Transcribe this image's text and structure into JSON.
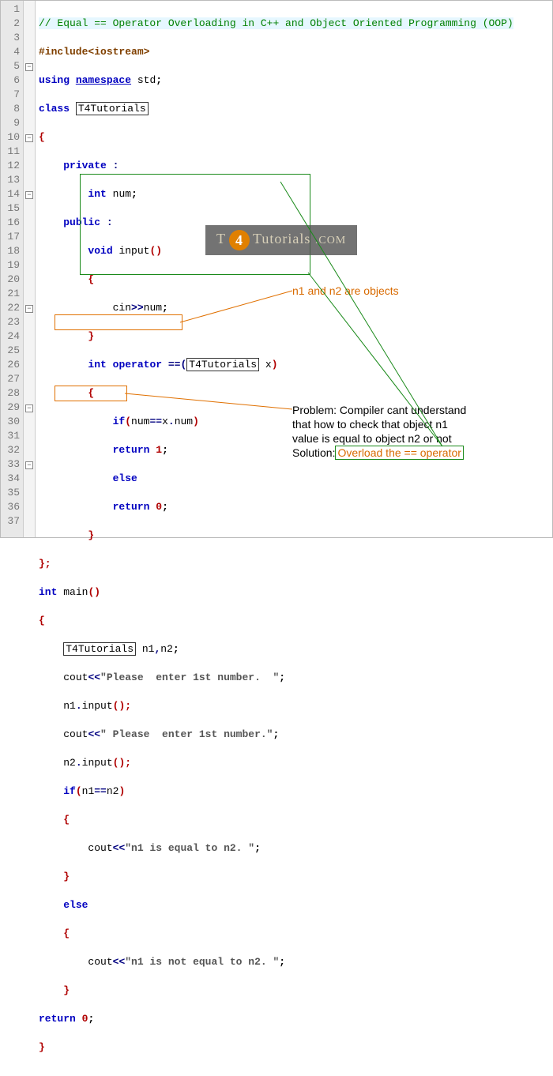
{
  "lines": {
    "count": 37,
    "folds": {
      "5": "⊟",
      "10": "⊟",
      "14": "⊟",
      "22": "⊟",
      "29": "⊟",
      "33": "⊟"
    }
  },
  "code": {
    "l1": "// Equal == Operator Overloading in C++ and Object Oriented Programming (OOP)",
    "l2a": "#include",
    "l2b": "<iostream>",
    "l3a": "using",
    "l3b": "namespace",
    "l3c": "std",
    "l3d": ";",
    "l4a": "class",
    "l4b": "T4Tutorials",
    "l5": "{",
    "l6a": "private",
    "l6b": ":",
    "l7a": "int",
    "l7b": "num",
    "l7c": ";",
    "l8a": "public",
    "l8b": ":",
    "l9a": "void",
    "l9b": "input",
    "l9c": "()",
    "l10": "{",
    "l11a": "cin",
    "l11b": ">>",
    "l11c": "num",
    "l11d": ";",
    "l12": "}",
    "l13a": "int",
    "l13b": "operator",
    "l13c": "==(",
    "l13d": "T4Tutorials",
    "l13e": "x",
    "l13f": ")",
    "l14": "{",
    "l15a": "if",
    "l15b": "(",
    "l15c": "num",
    "l15d": "==",
    "l15e": "x",
    "l15f": ".",
    "l15g": "num",
    "l15h": ")",
    "l16a": "return",
    "l16b": "1",
    "l16c": ";",
    "l17a": "else",
    "l18a": "return",
    "l18b": "0",
    "l18c": ";",
    "l19": "}",
    "l20": "};",
    "l21a": "int",
    "l21b": "main",
    "l21c": "()",
    "l22": "{",
    "l23a": "T4Tutorials",
    "l23b": "n1",
    "l23c": ",",
    "l23d": "n2",
    "l23e": ";",
    "l24a": "cout",
    "l24b": "<<",
    "l24c": "\"Please  enter 1st number.  \"",
    "l24d": ";",
    "l25a": "n1",
    "l25b": ".",
    "l25c": "input",
    "l25d": "();",
    "l26a": "cout",
    "l26b": "<<",
    "l26c": "\" Please  enter 1st number.\"",
    "l26d": ";",
    "l27a": "n2",
    "l27b": ".",
    "l27c": "input",
    "l27d": "();",
    "l28a": "if",
    "l28b": "(",
    "l28c": "n1",
    "l28d": "==",
    "l28e": "n2",
    "l28f": ")",
    "l29": "{",
    "l30a": "cout",
    "l30b": "<<",
    "l30c": "\"n1 is equal to n2. \"",
    "l30d": ";",
    "l31": "}",
    "l32a": "else",
    "l33": "{",
    "l34a": "cout",
    "l34b": "<<",
    "l34c": "\"n1 is not equal to n2. \"",
    "l34d": ";",
    "l35": "}",
    "l36a": "return",
    "l36b": "0",
    "l36c": ";",
    "l37": "}"
  },
  "annotations": {
    "objects": "n1 and n2 are objects",
    "problem_label": "Problem:",
    "problem_text1": "Compiler cant understand",
    "problem_text2": "that how to check that object n1",
    "problem_text3": "value is equal to object n2 or not",
    "solution_label": "Solution:",
    "solution_text": "Overload the == operator"
  },
  "watermark": {
    "prefix": "T",
    "circle": "4",
    "mid": "Tutorials",
    "suffix": ".COM"
  }
}
